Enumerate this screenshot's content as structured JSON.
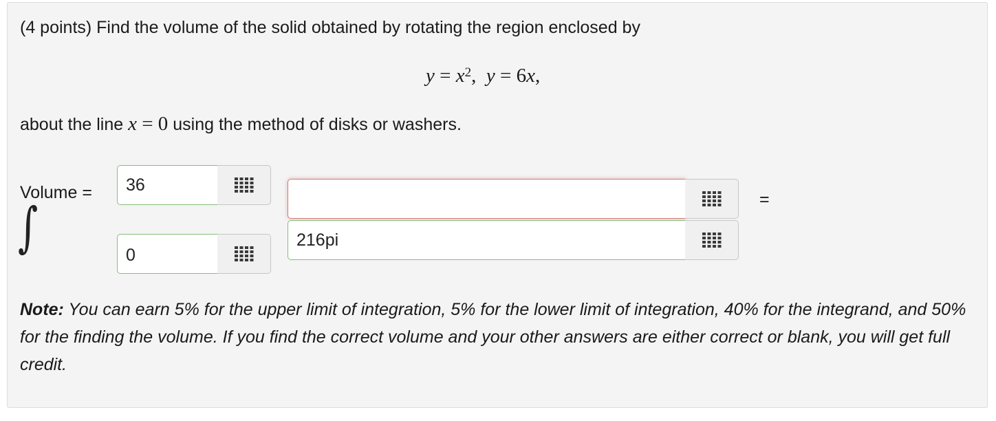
{
  "problem": {
    "intro": "(4 points) Find the volume of the solid obtained by rotating the region enclosed by",
    "eq_y1": "y",
    "eq_eq1": " = ",
    "eq_x": "x",
    "eq_exp": "2",
    "eq_sep": ",  ",
    "eq_y2": "y",
    "eq_eq2": " = 6",
    "eq_x2": "x",
    "eq_end": ",",
    "about_before": "about the line ",
    "about_var": "x",
    "about_eq": " = 0",
    "about_after": " using the method of disks or washers."
  },
  "form": {
    "volume_label": "Volume =",
    "integral_symbol": "∫",
    "upper_limit_value": "36",
    "lower_limit_value": "0",
    "integrand_value": "",
    "volume_value": "216pi",
    "equals_sign": "="
  },
  "note": {
    "label": "Note:",
    "text": " You can earn 5% for the upper limit of integration, 5% for the lower limit of integration, 40% for the integrand, and 50% for the finding the volume. If you find the correct volume and your other answers are either correct or blank, you will get full credit."
  },
  "colors": {
    "correct_border": "#86be7a",
    "incorrect_border": "#d47c7c",
    "panel_bg": "#f4f4f4"
  },
  "icons": {
    "grid_button": "grid-icon"
  }
}
